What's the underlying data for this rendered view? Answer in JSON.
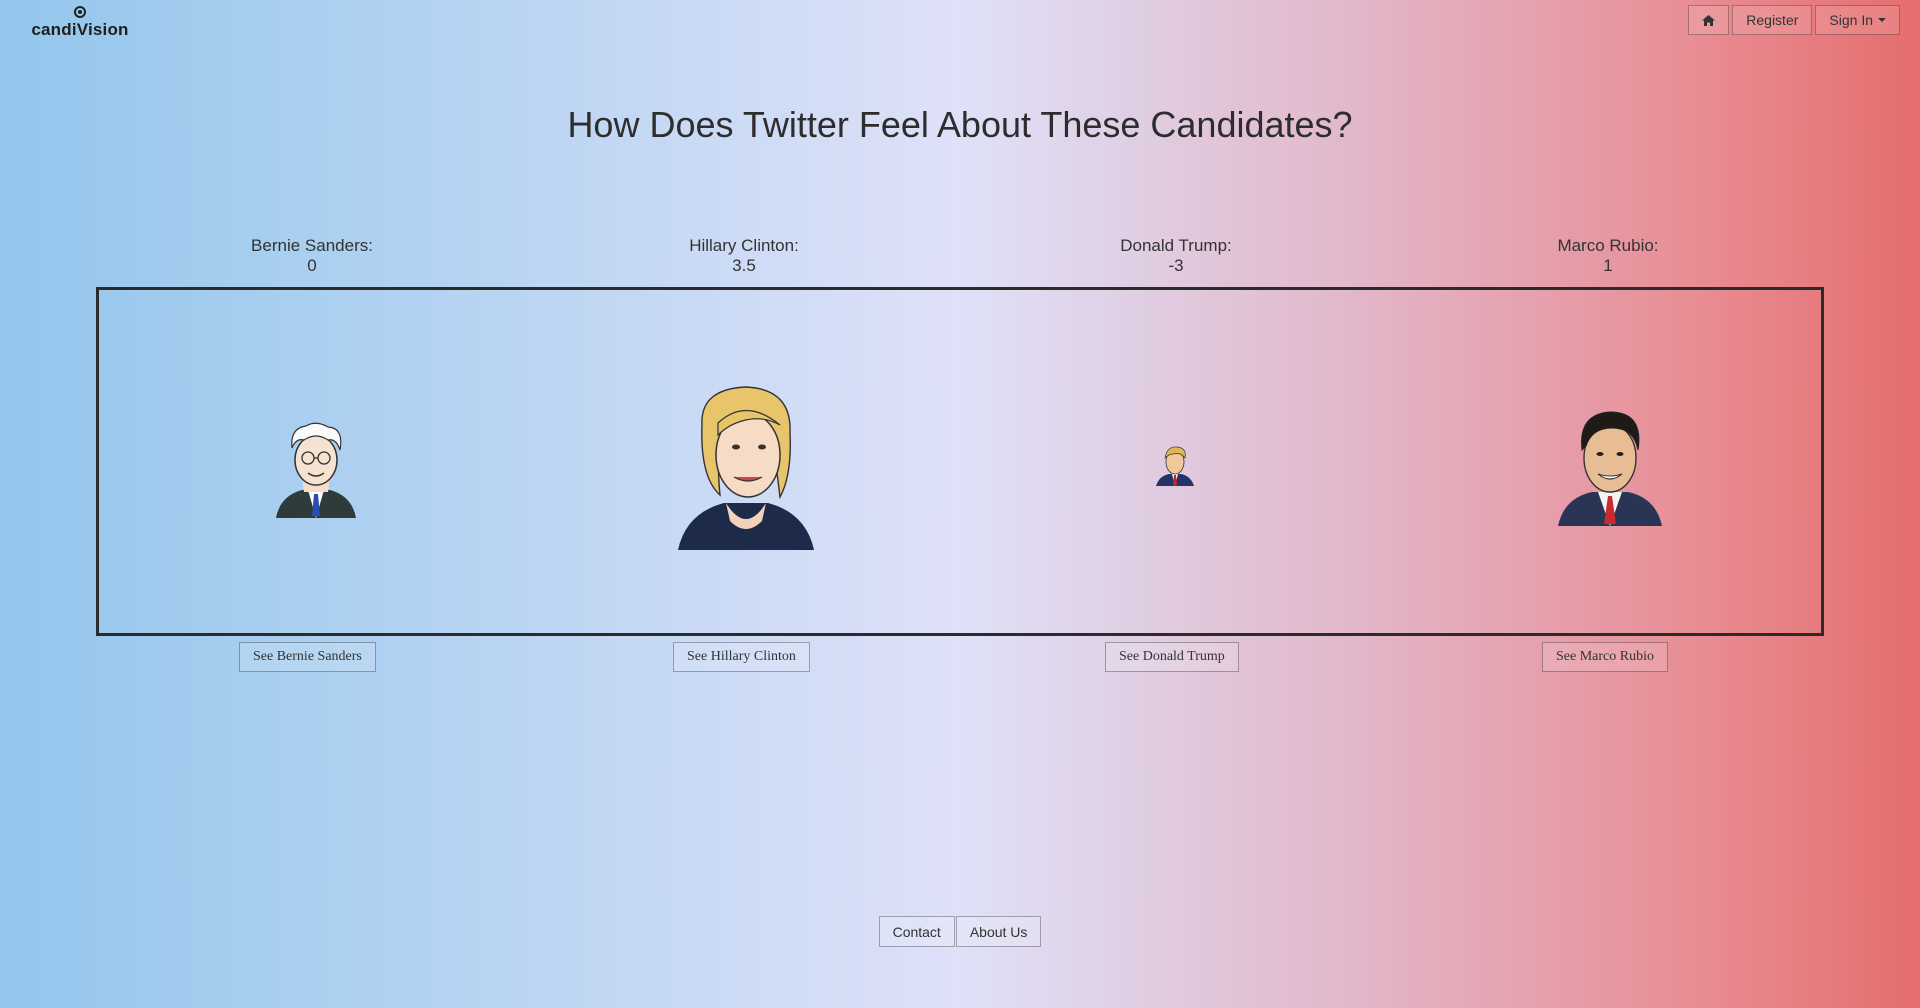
{
  "brand": {
    "name": "candiVision"
  },
  "nav": {
    "home_icon": "home-icon",
    "register_label": "Register",
    "signin_label": "Sign In"
  },
  "page": {
    "title": "How Does Twitter Feel About These Candidates?"
  },
  "candidates": [
    {
      "label": "Bernie Sanders:",
      "score": "0",
      "button": "See Bernie Sanders"
    },
    {
      "label": "Hillary Clinton:",
      "score": "3.5",
      "button": "See Hillary Clinton"
    },
    {
      "label": "Donald Trump:",
      "score": "-3",
      "button": "See Donald Trump"
    },
    {
      "label": "Marco Rubio:",
      "score": "1",
      "button": "See Marco Rubio"
    }
  ],
  "footer": {
    "contact_label": "Contact",
    "about_label": "About Us"
  },
  "colors": {
    "left_blue": "#93c6ec",
    "center": "#dfe1f8",
    "right_red": "#e56d6d",
    "border": "#2b2b2b"
  }
}
